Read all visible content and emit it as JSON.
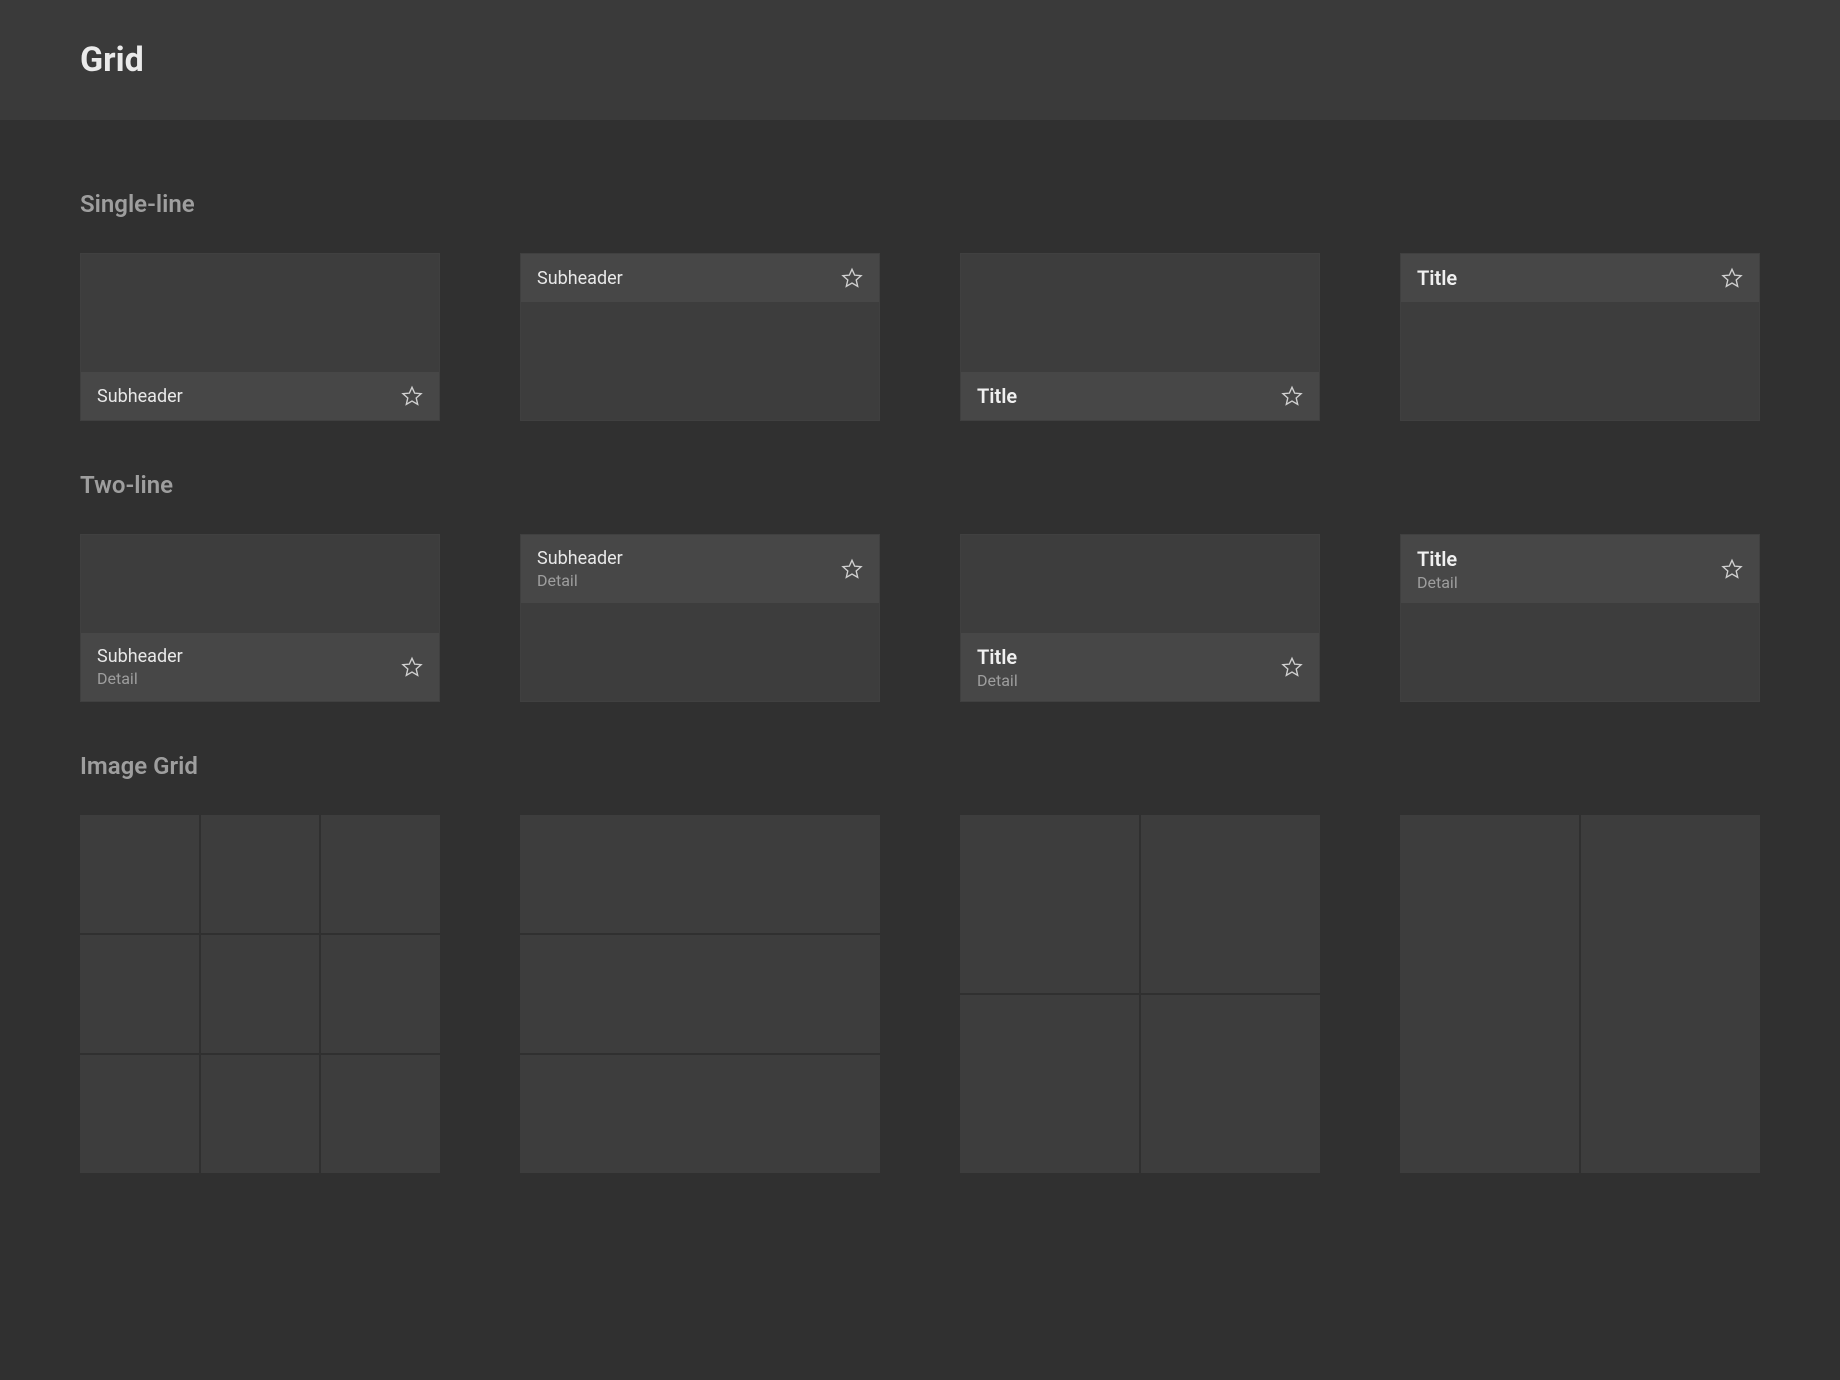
{
  "page": {
    "title": "Grid"
  },
  "sections": {
    "singleLine": {
      "heading": "Single-line",
      "tiles": [
        {
          "label": "Subheader",
          "style": "subheader",
          "position": "bottom",
          "hasStar": true
        },
        {
          "label": "Subheader",
          "style": "subheader",
          "position": "top",
          "hasStar": true
        },
        {
          "label": "Title",
          "style": "title",
          "position": "bottom",
          "hasStar": true
        },
        {
          "label": "Title",
          "style": "title",
          "position": "top",
          "hasStar": true
        }
      ]
    },
    "twoLine": {
      "heading": "Two-line",
      "tiles": [
        {
          "label": "Subheader",
          "detail": "Detail",
          "style": "subheader",
          "position": "bottom",
          "hasStar": true
        },
        {
          "label": "Subheader",
          "detail": "Detail",
          "style": "subheader",
          "position": "top",
          "hasStar": true
        },
        {
          "label": "Title",
          "detail": "Detail",
          "style": "title",
          "position": "bottom",
          "hasStar": true
        },
        {
          "label": "Title",
          "detail": "Detail",
          "style": "title",
          "position": "top",
          "hasStar": true
        }
      ]
    },
    "imageGrid": {
      "heading": "Image Grid",
      "grids": [
        {
          "cols": 3,
          "rows": 3
        },
        {
          "cols": 1,
          "rows": 3
        },
        {
          "cols": 2,
          "rows": 2
        },
        {
          "cols": 2,
          "rows": 1
        }
      ]
    }
  }
}
